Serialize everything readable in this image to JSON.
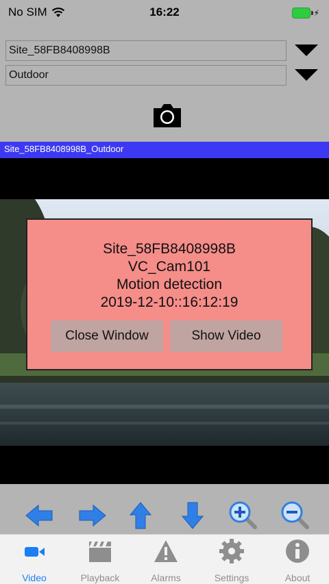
{
  "status": {
    "carrier": "No SIM",
    "time": "16:22"
  },
  "selects": {
    "site": "Site_58FB8408998B",
    "location": "Outdoor"
  },
  "title_bar": "Site_58FB8408998B_Outdoor",
  "alert": {
    "site": "Site_58FB8408998B",
    "camera": "VC_Cam101",
    "event": "Motion detection",
    "timestamp": "2019-12-10::16:12:19",
    "close_label": "Close Window",
    "show_label": "Show Video"
  },
  "ptz": [
    "arrow-left-icon",
    "arrow-right-icon",
    "arrow-up-icon",
    "arrow-down-icon",
    "zoom-in-icon",
    "zoom-out-icon"
  ],
  "tabs": [
    {
      "label": "Video",
      "icon": "video-camera-icon",
      "active": true
    },
    {
      "label": "Playback",
      "icon": "clapperboard-icon",
      "active": false
    },
    {
      "label": "Alarms",
      "icon": "warning-icon",
      "active": false
    },
    {
      "label": "Settings",
      "icon": "gear-icon",
      "active": false
    },
    {
      "label": "About",
      "icon": "info-icon",
      "active": false
    }
  ],
  "colors": {
    "accent": "#1b7ef2",
    "title_bar": "#3d39f2",
    "alert_bg": "#f58d89",
    "ptz_blue": "#2f7fe6"
  }
}
